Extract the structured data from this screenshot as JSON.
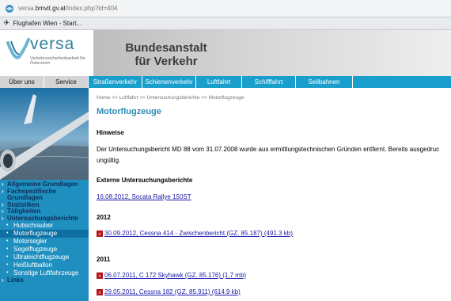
{
  "browser": {
    "url_prefix": "versa.",
    "url_host": "bmvit.gv.at",
    "url_path": "/index.php?id=404",
    "tab_label": "Flughafen Wien - Start..."
  },
  "header": {
    "logo_text": "versa",
    "logo_subtitle": "Verkehrssicherheitsarbeit für Österreich",
    "title_line1": "Bundesanstalt",
    "title_line2": "für Verkehr"
  },
  "nav": {
    "items": [
      {
        "label": "Über uns"
      },
      {
        "label": "Service"
      },
      {
        "label": "Straßenverkehr"
      },
      {
        "label": "Schienenverkehr"
      },
      {
        "label": "Luftfahrt"
      },
      {
        "label": "Schifffahrt"
      },
      {
        "label": "Seilbahnen"
      }
    ]
  },
  "sidebar": {
    "items": [
      {
        "label": "Allgemeine Grundlagen"
      },
      {
        "label": "Fachspezifische Grundlagen"
      },
      {
        "label": "Statistiken"
      },
      {
        "label": "Tätigkeiten"
      },
      {
        "label": "Untersuchungsberichte"
      }
    ],
    "subitems": [
      {
        "label": "Hubschrauber"
      },
      {
        "label": "Motorflugzeuge"
      },
      {
        "label": "Motorsegler"
      },
      {
        "label": "Segelflugzeuge"
      },
      {
        "label": "Ultraleichtflugzeuge"
      },
      {
        "label": "Heißluftballon"
      },
      {
        "label": "Sonstige Luftfahrzeuge"
      }
    ],
    "links_label": "Links"
  },
  "main": {
    "breadcrumb": "Home  >> Luftfahrt >> Untersuchungsberichte >> Motorflugzeuge",
    "title": "Motorflugzeuge",
    "hinweise_heading": "Hinweise",
    "notice_line1": "Der Untersuchungsbericht MD 88 vom 31.07.2008 wurde aus ermittlungstechnischen Gründen entfernt. Bereits ausgedruc",
    "notice_line2": "ungültig.",
    "external_heading": "Externe Untersuchungsberichte",
    "external_link": "16.08.2012, Socata Rallye 150ST",
    "year1": "2012",
    "report1": "30.09.2012, Cessna 414 - Zwischenbericht (GZ. 85.187) (491.3 kb)",
    "year2": "2011",
    "report2": "06.07.2011, C 172 Skyhawk (GZ. 85.176) (1.7 mb)",
    "report3": "29.05.2011, Cessna 182 (GZ. 85.911) (614.9 kb)"
  },
  "colors": {
    "accent_blue": "#1a9fcc",
    "sidebar_blue": "#1f8fc0",
    "link_blue": "#1a1aa8",
    "title_blue": "#2b8ab8"
  }
}
